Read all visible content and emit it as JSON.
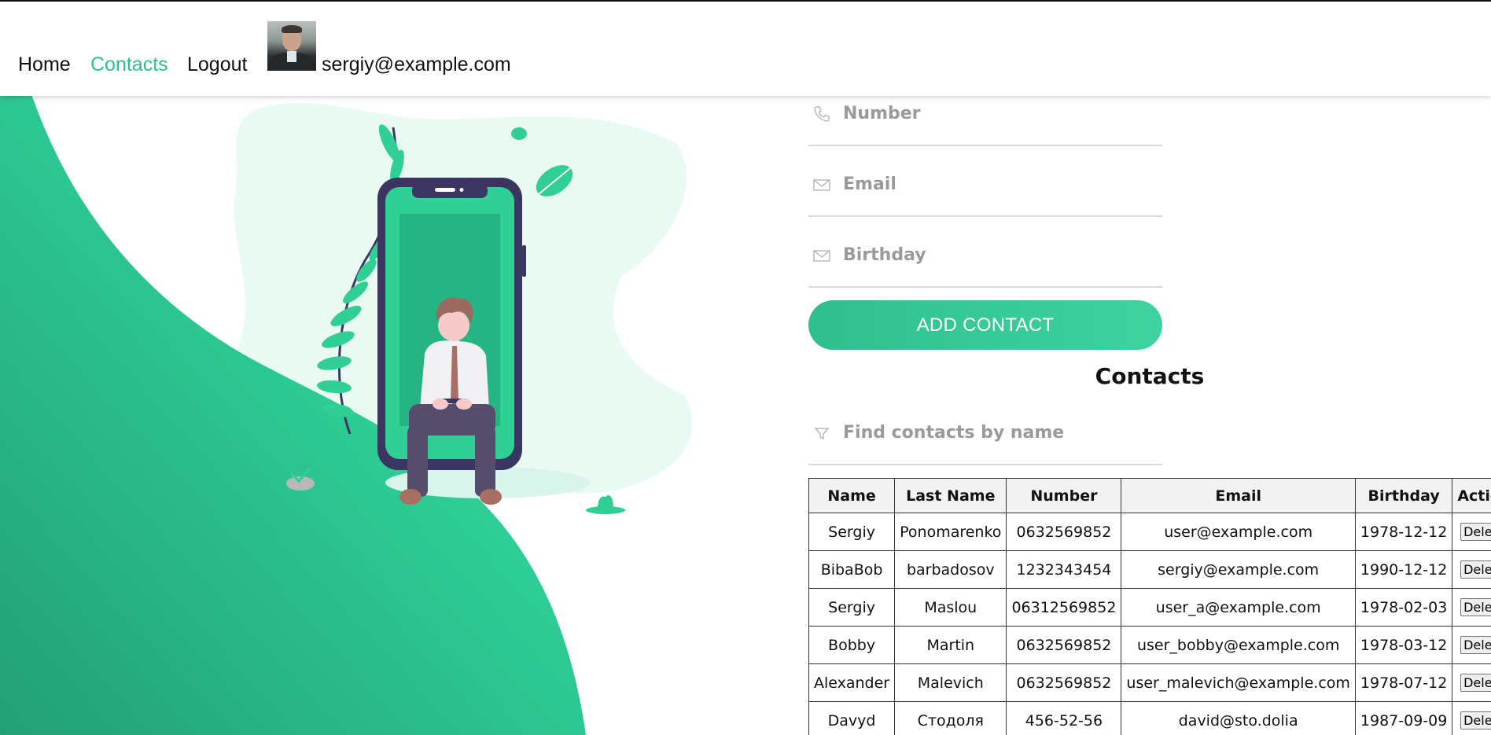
{
  "nav": {
    "home": "Home",
    "contacts": "Contacts",
    "logout": "Logout",
    "user_email": "sergiy@example.com",
    "active_color": "#2dbe8d"
  },
  "form": {
    "number_placeholder": "Number",
    "email_placeholder": "Email",
    "birthday_placeholder": "Birthday",
    "add_button": "ADD CONTACT"
  },
  "contacts": {
    "title": "Contacts",
    "filter_placeholder": "Find contacts by name",
    "headers": [
      "Name",
      "Last Name",
      "Number",
      "Email",
      "Birthday",
      "Action"
    ],
    "rows": [
      {
        "name": "Sergiy",
        "last_name": "Ponomarenko",
        "number": "0632569852",
        "email": "user@example.com",
        "birthday": "1978-12-12",
        "action": "Delete"
      },
      {
        "name": "BibaBob",
        "last_name": "barbadosov",
        "number": "1232343454",
        "email": "sergiy@example.com",
        "birthday": "1990-12-12",
        "action": "Delete"
      },
      {
        "name": "Sergiy",
        "last_name": "Maslou",
        "number": "06312569852",
        "email": "user_a@example.com",
        "birthday": "1978-02-03",
        "action": "Delete"
      },
      {
        "name": "Bobby",
        "last_name": "Martin",
        "number": "0632569852",
        "email": "user_bobby@example.com",
        "birthday": "1978-03-12",
        "action": "Delete"
      },
      {
        "name": "Alexander",
        "last_name": "Malevich",
        "number": "0632569852",
        "email": "user_malevich@example.com",
        "birthday": "1978-07-12",
        "action": "Delete"
      },
      {
        "name": "Davyd",
        "last_name": "Стодоля",
        "number": "456-52-56",
        "email": "david@sto.dolia",
        "birthday": "1987-09-09",
        "action": "Delete"
      }
    ]
  },
  "icons": {
    "number": "phone-icon",
    "email": "envelope-icon",
    "birthday": "envelope-icon",
    "filter": "funnel-icon"
  },
  "colors": {
    "brand_green": "#2dbe8d",
    "placeholder_gray": "#9a9a9a"
  }
}
